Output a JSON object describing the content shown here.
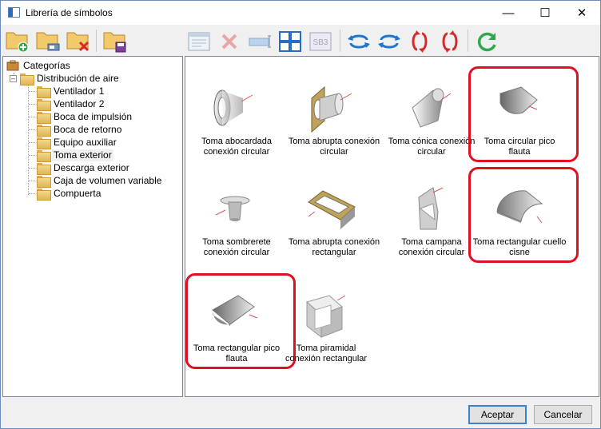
{
  "window": {
    "title": "Librería de símbolos",
    "minimize": "—",
    "maximize": "☐",
    "close": "✕"
  },
  "toolbar": {
    "buttons": [
      {
        "name": "new-folder-button",
        "icon": "folder-add-icon"
      },
      {
        "name": "edit-folder-button",
        "icon": "folder-edit-icon"
      },
      {
        "name": "delete-folder-button",
        "icon": "folder-delete-icon"
      },
      {
        "name": "save-folder-button",
        "icon": "folder-save-icon"
      },
      {
        "name": "properties-button",
        "icon": "window-icon"
      },
      {
        "name": "delete-symbol-button",
        "icon": "x-icon"
      },
      {
        "name": "rename-button",
        "icon": "textbox-icon"
      },
      {
        "name": "view-grid-button",
        "icon": "grid-icon"
      },
      {
        "name": "sb3-button",
        "icon": "sb3-icon",
        "text": "SB3"
      },
      {
        "name": "rotate-ccw-button",
        "icon": "rotate-left-icon"
      },
      {
        "name": "rotate-cw-button",
        "icon": "rotate-right-icon"
      },
      {
        "name": "flip-vertical-button",
        "icon": "flip-vertical-icon"
      },
      {
        "name": "flip-vertical-2-button",
        "icon": "flip-vertical-2-icon"
      },
      {
        "name": "refresh-button",
        "icon": "refresh-icon"
      }
    ]
  },
  "tree": {
    "root": "Categorías",
    "group": "Distribución de aire",
    "expander": "–",
    "items": [
      "Ventilador 1",
      "Ventilador 2",
      "Boca de impulsión",
      "Boca de retorno",
      "Equipo auxiliar",
      "Toma exterior",
      "Descarga exterior",
      "Caja de volumen variable",
      "Compuerta"
    ],
    "selected": "Toma exterior"
  },
  "symbols": [
    {
      "label_1": "Toma abocardada",
      "label_2": "conexión circular",
      "highlighted": false
    },
    {
      "label_1": "Toma abrupta conexión",
      "label_2": "circular",
      "highlighted": false
    },
    {
      "label_1": "Toma cónica conexión",
      "label_2": "circular",
      "highlighted": false
    },
    {
      "label_1": "Toma circular pico",
      "label_2": "flauta",
      "highlighted": true
    },
    {
      "label_1": "Toma sombrerete",
      "label_2": "conexión circular",
      "highlighted": false
    },
    {
      "label_1": "Toma abrupta conexión",
      "label_2": "rectangular",
      "highlighted": false
    },
    {
      "label_1": "Toma campana",
      "label_2": "conexión circular",
      "highlighted": false
    },
    {
      "label_1": "Toma rectangular cuello",
      "label_2": "cisne",
      "highlighted": true
    },
    {
      "label_1": "Toma rectangular pico",
      "label_2": "flauta",
      "highlighted": true
    },
    {
      "label_1": "Toma piramidal",
      "label_2": "conexión rectangular",
      "highlighted": false
    }
  ],
  "footer": {
    "accept": "Aceptar",
    "cancel": "Cancelar"
  },
  "colors": {
    "highlight": "#e01020",
    "accent": "#2a6bc4",
    "folder": "#e3b45a"
  }
}
